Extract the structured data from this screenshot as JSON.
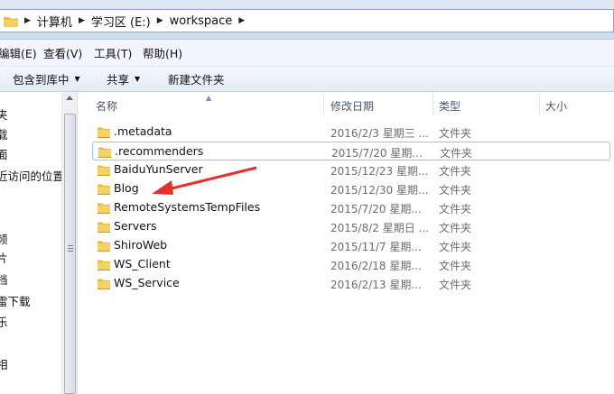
{
  "address": {
    "crumbs": [
      "计算机",
      "学习区 (E:)",
      "workspace"
    ]
  },
  "menubar": {
    "items": [
      "编辑(E)",
      "查看(V)",
      "工具(T)",
      "帮助(H)"
    ]
  },
  "toolbar": {
    "include_library": "包含到库中",
    "share": "共享",
    "new_folder": "新建文件夹"
  },
  "navpane": {
    "items": [
      "夹",
      "载",
      "面",
      "近访问的位置",
      "",
      "",
      "",
      "频",
      "片",
      "档",
      "雷下载",
      "乐",
      "",
      "",
      "相"
    ]
  },
  "columns": {
    "name": "名称",
    "date": "修改日期",
    "type": "类型",
    "size": "大小"
  },
  "files": [
    {
      "name": ".metadata",
      "date": "2016/2/3 星期三 ...",
      "type": "文件夹",
      "selected": false
    },
    {
      "name": ".recommenders",
      "date": "2015/7/20 星期...",
      "type": "文件夹",
      "selected": true
    },
    {
      "name": "BaiduYunServer",
      "date": "2015/12/23 星期...",
      "type": "文件夹",
      "selected": false
    },
    {
      "name": "Blog",
      "date": "2015/12/30 星期...",
      "type": "文件夹",
      "selected": false
    },
    {
      "name": "RemoteSystemsTempFiles",
      "date": "2015/7/20 星期...",
      "type": "文件夹",
      "selected": false
    },
    {
      "name": "Servers",
      "date": "2015/8/2 星期日 ...",
      "type": "文件夹",
      "selected": false
    },
    {
      "name": "ShiroWeb",
      "date": "2015/11/7 星期...",
      "type": "文件夹",
      "selected": false
    },
    {
      "name": "WS_Client",
      "date": "2016/2/18 星期...",
      "type": "文件夹",
      "selected": false
    },
    {
      "name": "WS_Service",
      "date": "2016/2/13 星期...",
      "type": "文件夹",
      "selected": false
    }
  ],
  "colors": {
    "folder": "#e8b93a",
    "annotation_arrow": "#e8302a",
    "selection_border": "#9dc4ea"
  }
}
